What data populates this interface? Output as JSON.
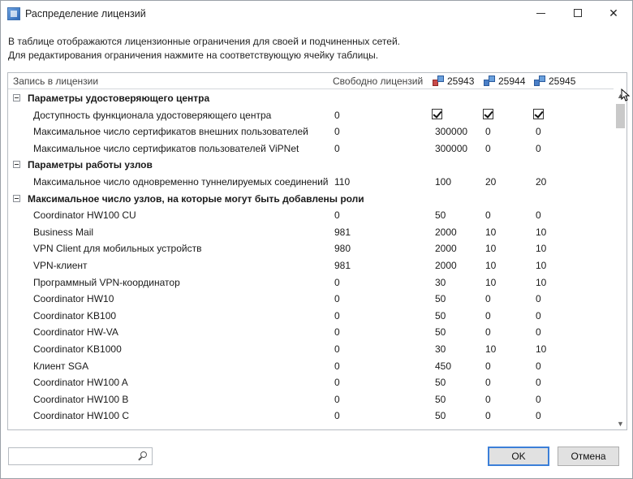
{
  "window": {
    "title": "Распределение лицензий",
    "description_line1": "В таблице отображаются лицензионные ограничения для своей и подчиненных сетей.",
    "description_line2": "Для редактирования ограничения нажмите на соответствующую ячейку таблицы."
  },
  "grid": {
    "columns": {
      "record": "Запись в лицензии",
      "free": "Свободно лицензий",
      "net1": "25943",
      "net2": "25944",
      "net3": "25945"
    },
    "rows": [
      {
        "type": "group",
        "label": "Параметры удостоверяющего центра"
      },
      {
        "type": "item",
        "label": "Доступность функционала удостоверяющего центра",
        "free": "0",
        "v1": "check",
        "v2": "check",
        "v3": "check"
      },
      {
        "type": "item",
        "label": "Максимальное число сертификатов внешних пользователей",
        "free": "0",
        "v1": "300000",
        "v2": "0",
        "v3": "0"
      },
      {
        "type": "item",
        "label": "Максимальное число сертификатов пользователей ViPNet",
        "free": "0",
        "v1": "300000",
        "v2": "0",
        "v3": "0"
      },
      {
        "type": "group",
        "label": "Параметры работы узлов"
      },
      {
        "type": "item",
        "label": "Максимальное число одновременно туннелируемых соединений",
        "free": "110",
        "v1": "100",
        "v2": "20",
        "v3": "20"
      },
      {
        "type": "group",
        "label": "Максимальное число узлов, на которые могут быть добавлены роли"
      },
      {
        "type": "item",
        "label": "Coordinator HW100 CU",
        "free": "0",
        "v1": "50",
        "v2": "0",
        "v3": "0"
      },
      {
        "type": "item",
        "label": "Business Mail",
        "free": "981",
        "v1": "2000",
        "v2": "10",
        "v3": "10"
      },
      {
        "type": "item",
        "label": "VPN Client для мобильных устройств",
        "free": "980",
        "v1": "2000",
        "v2": "10",
        "v3": "10"
      },
      {
        "type": "item",
        "label": "VPN-клиент",
        "free": "981",
        "v1": "2000",
        "v2": "10",
        "v3": "10"
      },
      {
        "type": "item",
        "label": "Программный VPN-координатор",
        "free": "0",
        "v1": "30",
        "v2": "10",
        "v3": "10"
      },
      {
        "type": "item",
        "label": "Coordinator HW10",
        "free": "0",
        "v1": "50",
        "v2": "0",
        "v3": "0"
      },
      {
        "type": "item",
        "label": "Coordinator KB100",
        "free": "0",
        "v1": "50",
        "v2": "0",
        "v3": "0"
      },
      {
        "type": "item",
        "label": "Coordinator HW-VA",
        "free": "0",
        "v1": "50",
        "v2": "0",
        "v3": "0"
      },
      {
        "type": "item",
        "label": "Coordinator KB1000",
        "free": "0",
        "v1": "30",
        "v2": "10",
        "v3": "10"
      },
      {
        "type": "item",
        "label": "Клиент SGA",
        "free": "0",
        "v1": "450",
        "v2": "0",
        "v3": "0"
      },
      {
        "type": "item",
        "label": "Coordinator HW100 A",
        "free": "0",
        "v1": "50",
        "v2": "0",
        "v3": "0"
      },
      {
        "type": "item",
        "label": "Coordinator HW100 B",
        "free": "0",
        "v1": "50",
        "v2": "0",
        "v3": "0"
      },
      {
        "type": "item",
        "label": "Coordinator HW100 C",
        "free": "0",
        "v1": "50",
        "v2": "0",
        "v3": "0"
      }
    ]
  },
  "search": {
    "value": "",
    "placeholder": ""
  },
  "buttons": {
    "ok": "OK",
    "cancel": "Отмена"
  },
  "icons": {
    "net1_icon": "network-red-icon",
    "net2_icon": "network-blue-icon",
    "net3_icon": "network-blue-icon"
  }
}
